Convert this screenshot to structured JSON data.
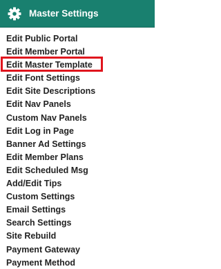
{
  "header": {
    "title": "Master Settings",
    "icon": "gear-icon",
    "background_color": "#19806f"
  },
  "menu": {
    "items": [
      {
        "label": "Edit Public Portal"
      },
      {
        "label": "Edit Member Portal"
      },
      {
        "label": "Edit Master Template",
        "highlighted": true
      },
      {
        "label": "Edit Font Settings"
      },
      {
        "label": "Edit Site Descriptions"
      },
      {
        "label": "Edit Nav Panels"
      },
      {
        "label": "Custom Nav Panels"
      },
      {
        "label": "Edit Log in Page"
      },
      {
        "label": "Banner Ad Settings"
      },
      {
        "label": "Edit Member Plans"
      },
      {
        "label": "Edit Scheduled Msg"
      },
      {
        "label": "Add/Edit Tips"
      },
      {
        "label": "Custom Settings"
      },
      {
        "label": "Email Settings"
      },
      {
        "label": "Search Settings"
      },
      {
        "label": "Site Rebuild"
      },
      {
        "label": "Payment Gateway"
      },
      {
        "label": "Payment Method"
      }
    ],
    "highlight_color": "#e0141d"
  }
}
